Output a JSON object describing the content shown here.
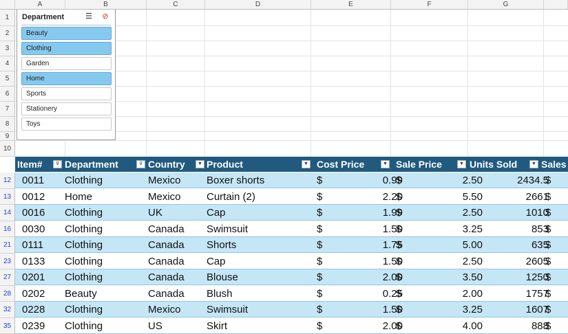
{
  "columns": [
    "A",
    "B",
    "C",
    "D",
    "E",
    "F",
    "G"
  ],
  "row_numbers_top": [
    "1",
    "2",
    "3",
    "4",
    "5",
    "6",
    "7",
    "8",
    "9",
    "10"
  ],
  "filtered_row_numbers": [
    "12",
    "13",
    "14",
    "16",
    "21",
    "23",
    "27",
    "28",
    "32",
    "35"
  ],
  "slicer": {
    "title": "Department",
    "multiselect_icon": "☰",
    "clear_icon": "⊘",
    "items": [
      {
        "label": "Beauty",
        "selected": true
      },
      {
        "label": "Clothing",
        "selected": true
      },
      {
        "label": "Garden",
        "selected": false
      },
      {
        "label": "Home",
        "selected": true
      },
      {
        "label": "Sports",
        "selected": false
      },
      {
        "label": "Stationery",
        "selected": false
      },
      {
        "label": "Toys",
        "selected": false
      }
    ]
  },
  "table": {
    "headers": [
      "Item#",
      "Department",
      "Country",
      "Product",
      "Cost Price",
      "Sale Price",
      "Units Sold",
      "Sales"
    ],
    "filter_glyph": "▼",
    "active_filter_glyph": "⊽",
    "currency": "$",
    "rows": [
      {
        "item": "0011",
        "dept": "Clothing",
        "country": "Mexico",
        "product": "Boxer shorts",
        "cost": "0.99",
        "sale": "2.50",
        "units": "2434.5"
      },
      {
        "item": "0012",
        "dept": "Home",
        "country": "Mexico",
        "product": "Curtain (2)",
        "cost": "2.20",
        "sale": "5.50",
        "units": "2661"
      },
      {
        "item": "0016",
        "dept": "Clothing",
        "country": "UK",
        "product": "Cap",
        "cost": "1.99",
        "sale": "2.50",
        "units": "1010"
      },
      {
        "item": "0030",
        "dept": "Clothing",
        "country": "Canada",
        "product": "Swimsuit",
        "cost": "1.50",
        "sale": "3.25",
        "units": "853"
      },
      {
        "item": "0111",
        "dept": "Clothing",
        "country": "Canada",
        "product": "Shorts",
        "cost": "1.75",
        "sale": "5.00",
        "units": "635"
      },
      {
        "item": "0133",
        "dept": "Clothing",
        "country": "Canada",
        "product": "Cap",
        "cost": "1.50",
        "sale": "2.50",
        "units": "2605"
      },
      {
        "item": "0201",
        "dept": "Clothing",
        "country": "Canada",
        "product": "Blouse",
        "cost": "2.00",
        "sale": "3.50",
        "units": "1250"
      },
      {
        "item": "0202",
        "dept": "Beauty",
        "country": "Canada",
        "product": "Blush",
        "cost": "0.25",
        "sale": "2.00",
        "units": "1757"
      },
      {
        "item": "0228",
        "dept": "Clothing",
        "country": "Mexico",
        "product": "Swimsuit",
        "cost": "1.50",
        "sale": "3.25",
        "units": "1607"
      },
      {
        "item": "0239",
        "dept": "Clothing",
        "country": "US",
        "product": "Skirt",
        "cost": "2.00",
        "sale": "4.00",
        "units": "888"
      }
    ]
  }
}
